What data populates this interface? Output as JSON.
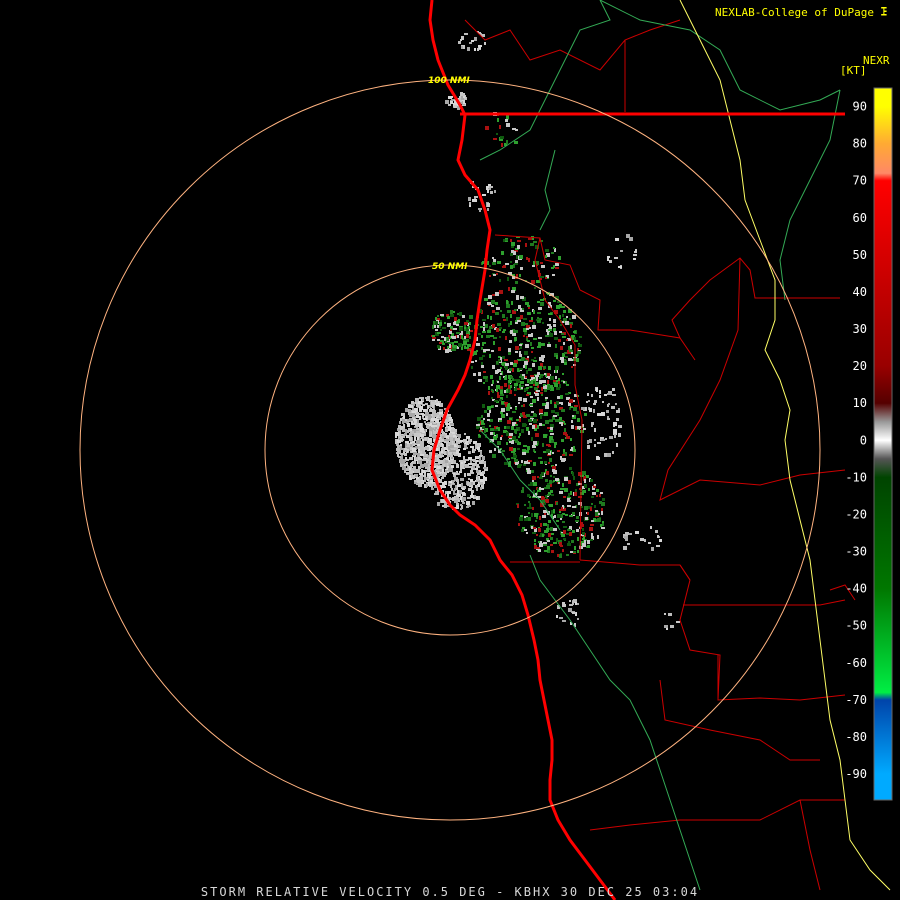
{
  "header": {
    "credit": "NEXLAB-College of DuPage",
    "product": "NEXR",
    "units": "[KT]"
  },
  "footer": {
    "caption": "STORM RELATIVE VELOCITY 0.5 DEG - KBHX 30 DEC 25 03:04"
  },
  "range_rings": [
    {
      "label": "50 NMI"
    },
    {
      "label": "100 NMI"
    }
  ],
  "colorbar": {
    "ticks": [
      "90",
      "80",
      "70",
      "60",
      "50",
      "40",
      "30",
      "20",
      "10",
      "0",
      "-10",
      "-20",
      "-30",
      "-40",
      "-50",
      "-60",
      "-70",
      "-80",
      "-90"
    ],
    "stops": [
      {
        "value": 90,
        "color": "#ffff00"
      },
      {
        "value": 80,
        "color": "#ffaa33"
      },
      {
        "value": 72,
        "color": "#ff8866"
      },
      {
        "value": 70,
        "color": "#ff0000"
      },
      {
        "value": 20,
        "color": "#990000"
      },
      {
        "value": 10,
        "color": "#550000"
      },
      {
        "value": 5,
        "color": "#999999"
      },
      {
        "value": 0,
        "color": "#ffffff"
      },
      {
        "value": -5,
        "color": "#555555"
      },
      {
        "value": -10,
        "color": "#004400"
      },
      {
        "value": -40,
        "color": "#007700"
      },
      {
        "value": -68,
        "color": "#00ee44"
      },
      {
        "value": -70,
        "color": "#0044aa"
      },
      {
        "value": -90,
        "color": "#00aaff"
      }
    ]
  },
  "colors": {
    "coastline": "#ff0000",
    "county_lines": "#cc0000",
    "rivers": "#33aa55",
    "highway": "#ffff66",
    "range_ring": "#ffb380"
  }
}
